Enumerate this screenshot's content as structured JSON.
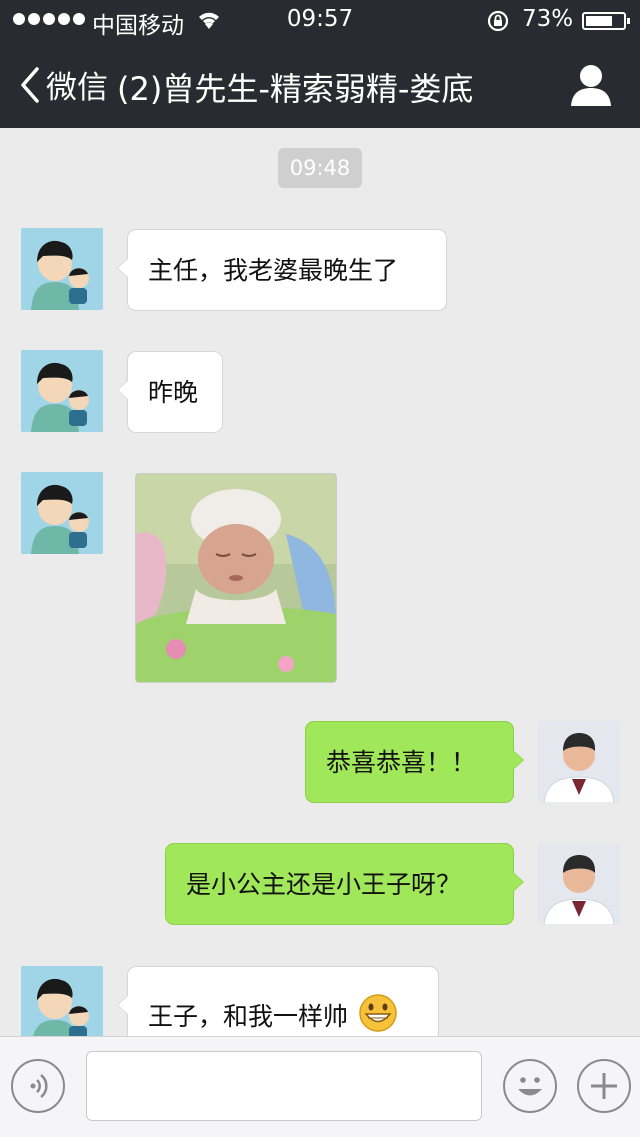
{
  "status_bar": {
    "carrier": "中国移动",
    "time": "09:57",
    "battery": "73%",
    "battery_level": 0.73
  },
  "nav": {
    "back_label": "微信",
    "title": "(2)曾先生-精索弱精-娄底"
  },
  "chat": {
    "timestamp": "09:48",
    "messages": [
      {
        "sender": "other",
        "type": "text",
        "text": "主任，我老婆最晚生了"
      },
      {
        "sender": "other",
        "type": "text",
        "text": "昨晚"
      },
      {
        "sender": "other",
        "type": "image"
      },
      {
        "sender": "self",
        "type": "text",
        "text": "恭喜恭喜！！"
      },
      {
        "sender": "self",
        "type": "text",
        "text": "是小公主还是小王子呀？"
      },
      {
        "sender": "other",
        "type": "text",
        "text": "王子，和我一样帅",
        "emoji": "grinning-face"
      }
    ]
  },
  "input_bar": {
    "value": "",
    "voice_icon": "voice-icon",
    "emoji_icon": "emoji-icon",
    "plus_icon": "plus-icon"
  },
  "colors": {
    "header_bg": "#2a2b30",
    "chat_bg": "#ebebeb",
    "self_bubble": "#a0e75a",
    "other_bubble": "#ffffff"
  }
}
